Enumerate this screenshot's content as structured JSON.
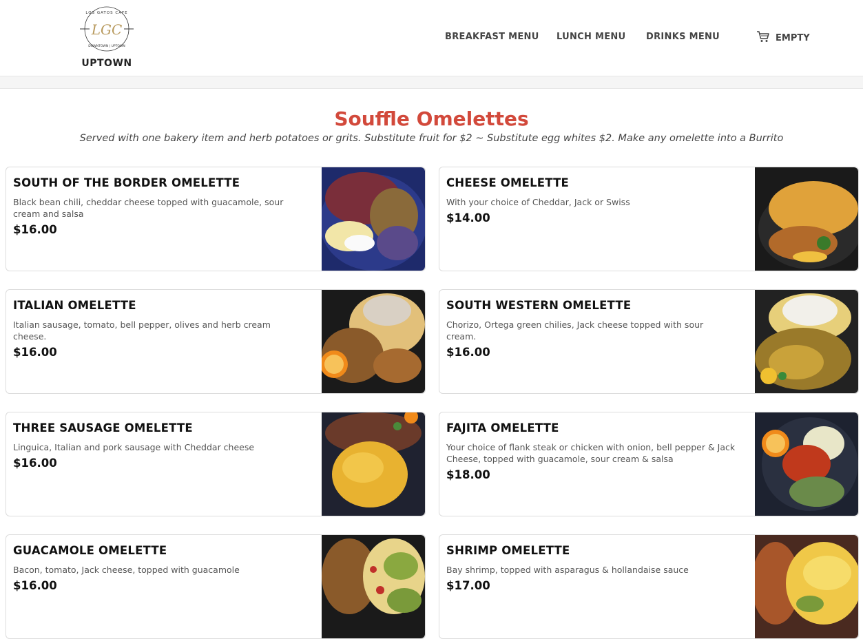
{
  "brand": {
    "logo_initials": "LGC",
    "logo_ring_top": "LOS GATOS CAFE",
    "logo_ring_bottom": "DOWNTOWN | UPTOWN",
    "location": "UPTOWN"
  },
  "nav": {
    "breakfast": "BREAKFAST MENU",
    "lunch": "LUNCH MENU",
    "drinks": "DRINKS MENU",
    "cart_icon": "cart-icon",
    "cart_label": "EMPTY"
  },
  "section": {
    "title": "Souffle Omelettes",
    "subtitle": "Served with one bakery item and herb potatoes or grits. Substitute fruit for $2 ~ Substitute egg whites $2. Make any omelette into a Burrito"
  },
  "items": [
    {
      "name": "SOUTH OF THE BORDER OMELETTE",
      "desc": "Black bean chili, cheddar cheese topped with guacamole, sour cream and salsa",
      "price": "$16.00"
    },
    {
      "name": "CHEESE OMELETTE",
      "desc": "With your choice of Cheddar, Jack or Swiss",
      "price": "$14.00"
    },
    {
      "name": "ITALIAN OMELETTE",
      "desc": "Italian sausage, tomato, bell pepper, olives and herb cream cheese.",
      "price": "$16.00"
    },
    {
      "name": "SOUTH WESTERN OMELETTE",
      "desc": "Chorizo, Ortega green chilies, Jack cheese topped with sour cream.",
      "price": "$16.00"
    },
    {
      "name": "THREE SAUSAGE OMELETTE",
      "desc": "Linguica, Italian and pork sausage with Cheddar cheese",
      "price": "$16.00"
    },
    {
      "name": "FAJITA OMELETTE",
      "desc": "Your choice of flank steak or chicken with onion, bell pepper & Jack Cheese, topped with guacamole, sour cream & salsa",
      "price": "$18.00"
    },
    {
      "name": "GUACAMOLE OMELETTE",
      "desc": "Bacon, tomato, Jack cheese, topped with guacamole",
      "price": "$16.00"
    },
    {
      "name": "SHRIMP OMELETTE",
      "desc": "Bay shrimp, topped with asparagus & hollandaise sauce",
      "price": "$17.00"
    }
  ],
  "colors": {
    "accent": "#d2493b",
    "logo_gold": "#b89a5e"
  }
}
